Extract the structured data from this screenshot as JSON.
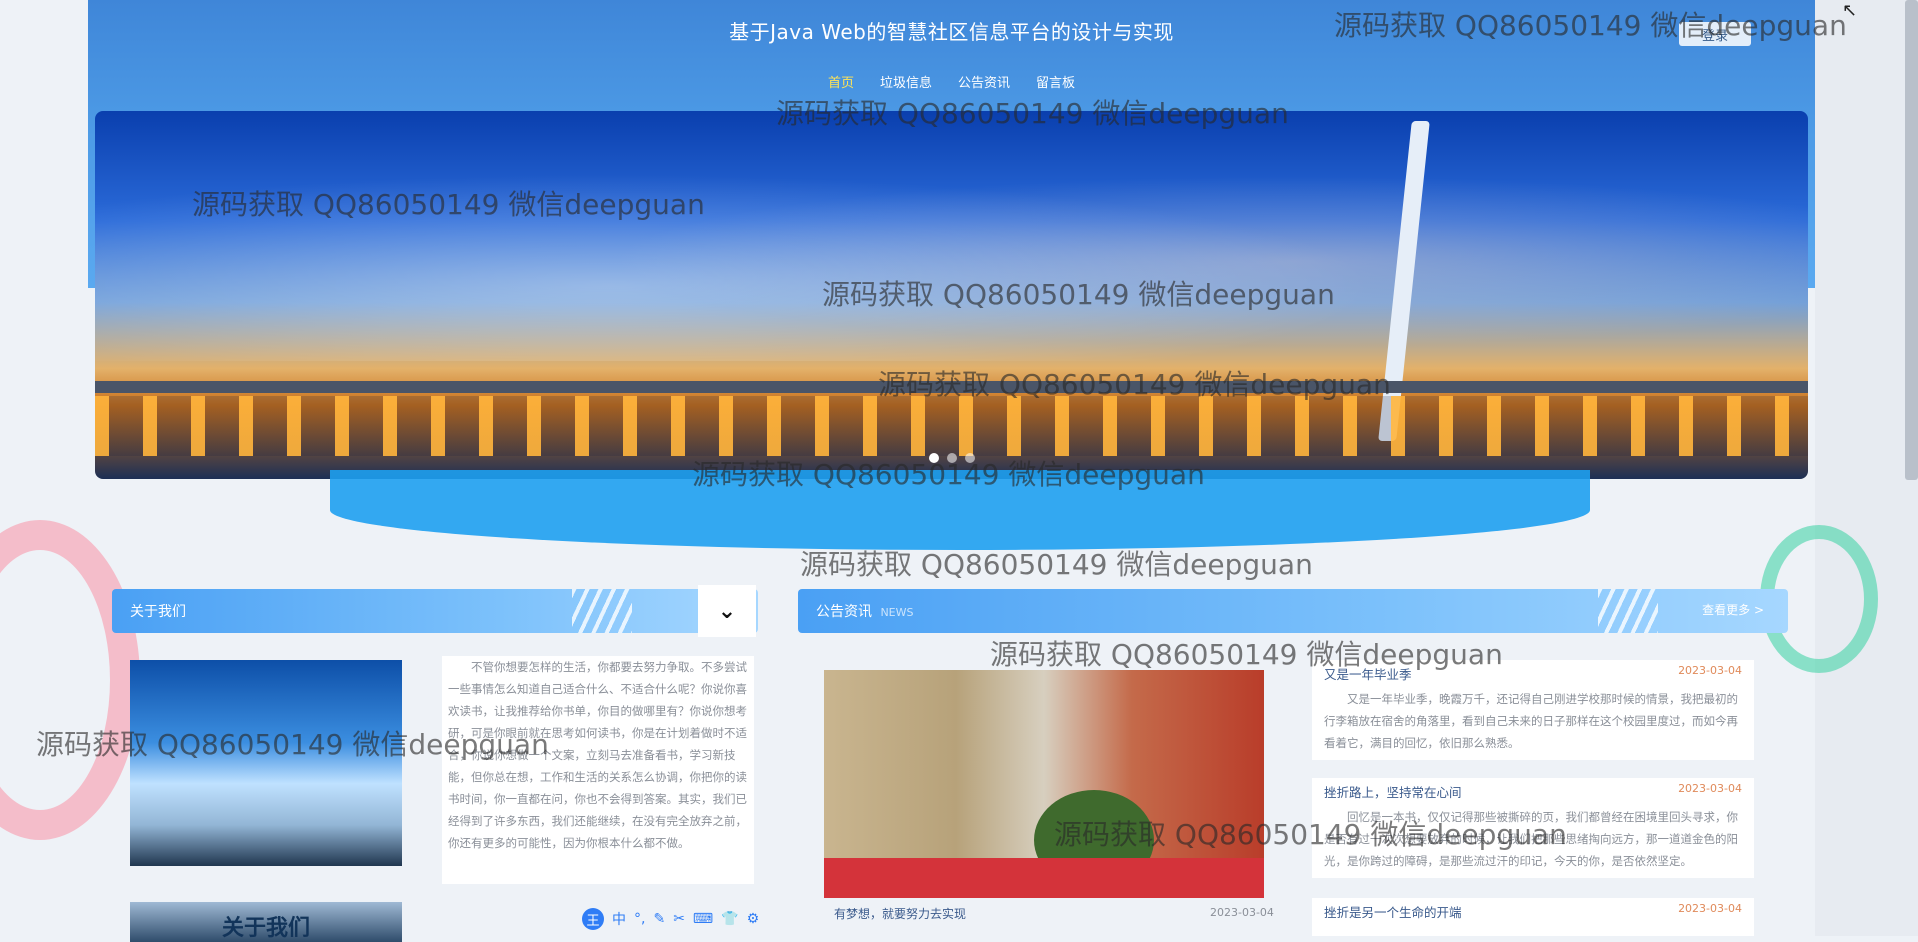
{
  "header": {
    "title": "基于Java Web的智慧社区信息平台的设计与实现",
    "login_label": "登录",
    "nav": [
      "首页",
      "垃圾信息",
      "公告资讯",
      "留言板"
    ]
  },
  "banner": {
    "slides": 3,
    "active_slide": 1
  },
  "about": {
    "title": "关于我们",
    "text": "不管你想要怎样的生活，你都要去努力争取。不多尝试一些事情怎么知道自己适合什么、不适合什么呢？你说你喜欢读书，让我推荐给你书单，你目的做哪里有？你说你想考研，可是你眼前就在思考如何读书，你是在计划着做时不适合，你说你想做一个文案，立刻马去准备看书，学习新技能，但你总在想，工作和生活的关系怎么协调，你把你的读书时间，你一直都在问，你也不会得到答案。其实，我们已经得到了许多东西，我们还能继续，在没有完全放弃之前，你还有更多的可能性，因为你根本什么都不做。",
    "image_caption": "关于我们"
  },
  "news": {
    "title": "公告资讯",
    "subtitle": "NEWS",
    "more_label": "查看更多 >",
    "featured_caption": "有梦想，就要努力去实现",
    "featured_date": "2023-03-04",
    "items": [
      {
        "title": "又是一年毕业季",
        "date": "2023-03-04",
        "body": "又是一年毕业季，晚霞万千，还记得自己刚进学校那时候的情景，我把最初的行李箱放在宿舍的角落里，看到自己未来的日子那样在这个校园里度过，而如今再看着它，满目的回忆，依旧那么熟悉。"
      },
      {
        "title": "挫折路上，坚持常在心间",
        "date": "2023-03-04",
        "body": "回忆是一本书，仅仅记得那些被撕碎的页，我们都曾经在困境里回头寻求，你是否有过一次次想要放弃的时候，让我们把那些思绪掏向远方，那一道道金色的阳光，是你跨过的障碍，是那些流过汗的印记，今天的你，是否依然坚定。"
      },
      {
        "title": "挫折是另一个生命的开端",
        "date": "2023-03-04",
        "body": ""
      }
    ]
  },
  "ime_toolbar": [
    "中",
    "°,",
    "✎",
    "✂",
    "⌨",
    "👕",
    "⚙"
  ],
  "watermark_text": "源码获取 QQ86050149 微信deepguan"
}
